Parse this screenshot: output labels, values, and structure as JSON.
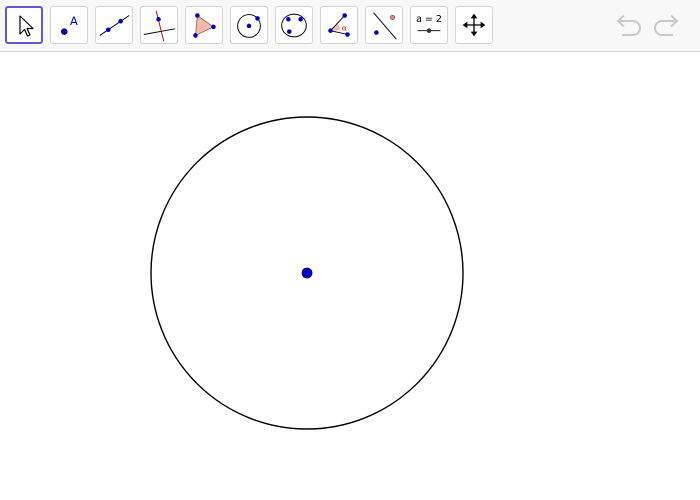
{
  "toolbar": {
    "tools": [
      {
        "name": "move-tool",
        "selected": true
      },
      {
        "name": "point-tool",
        "label": "A"
      },
      {
        "name": "line-tool"
      },
      {
        "name": "perpendicular-line-tool"
      },
      {
        "name": "polygon-tool"
      },
      {
        "name": "circle-with-center-tool"
      },
      {
        "name": "circle-through-3-points-tool"
      },
      {
        "name": "angle-tool",
        "label": "α"
      },
      {
        "name": "reflect-about-line-tool"
      },
      {
        "name": "slider-tool",
        "label": "a = 2"
      },
      {
        "name": "move-graphics-view-tool"
      }
    ],
    "undo_icon": "undo-icon",
    "redo_icon": "redo-icon"
  },
  "colors": {
    "selected_border": "#6557d2",
    "point_fill": "#0000cc",
    "point_red": "#cc0000",
    "polygon_fill": "#f4b9a8",
    "disabled": "#c8c8c8",
    "circle_stroke": "#000000"
  }
}
